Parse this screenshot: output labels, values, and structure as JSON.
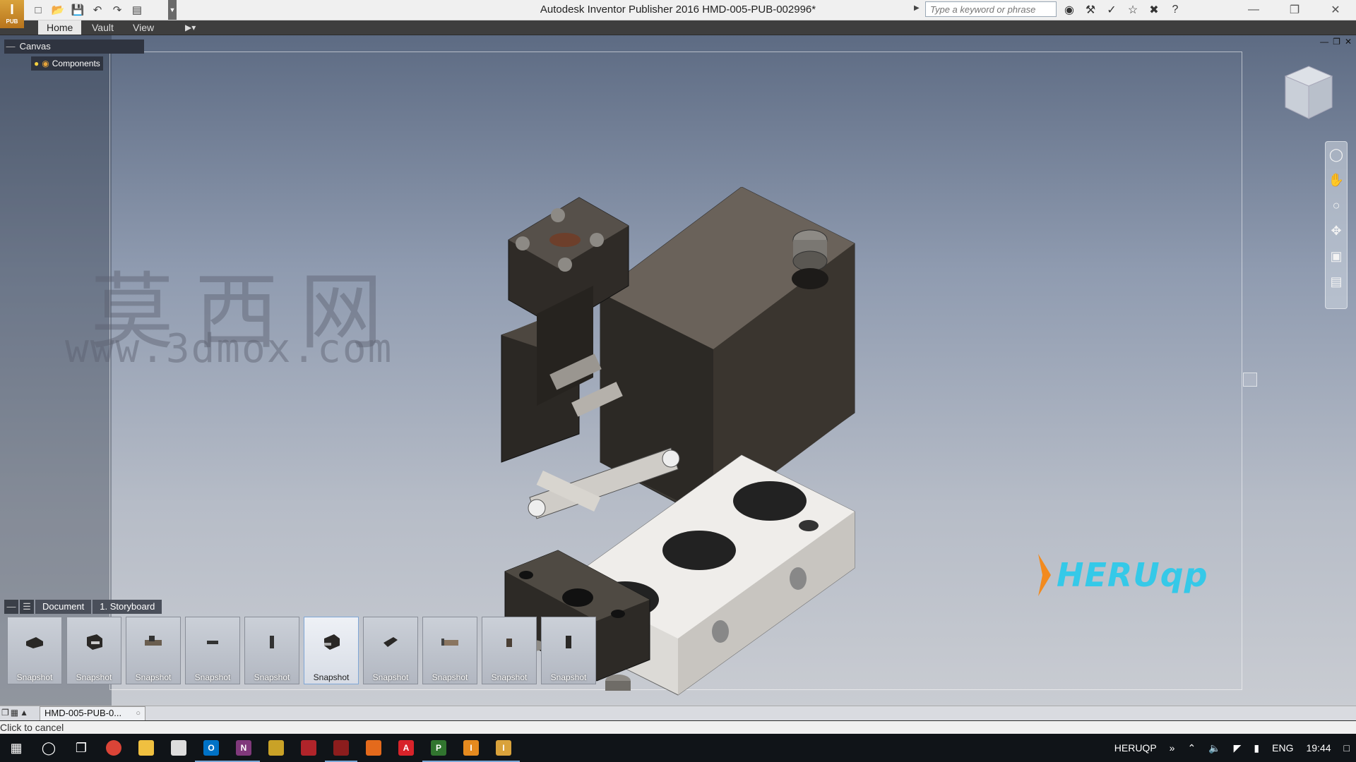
{
  "app": {
    "window_title": "Autodesk Inventor Publisher 2016    HMD-005-PUB-002996*",
    "logo_label": "PUB"
  },
  "search": {
    "placeholder": "Type a keyword or phrase"
  },
  "ribbon": {
    "tabs": [
      "Home",
      "Vault",
      "View"
    ],
    "active_tab": "Home"
  },
  "browser": {
    "header": "Canvas",
    "node": "Components"
  },
  "watermark": {
    "cn": "莫西网",
    "url": "www.3dmox.com"
  },
  "brand_logo": {
    "text": "HERUqp"
  },
  "storyboard": {
    "crumbs": [
      "Document",
      "1. Storyboard"
    ],
    "snapshots": [
      {
        "label": "Snapshot",
        "selected": false
      },
      {
        "label": "Snapshot",
        "selected": false
      },
      {
        "label": "Snapshot",
        "selected": false
      },
      {
        "label": "Snapshot",
        "selected": false
      },
      {
        "label": "Snapshot",
        "selected": false
      },
      {
        "label": "Snapshot",
        "selected": true
      },
      {
        "label": "Snapshot",
        "selected": false
      },
      {
        "label": "Snapshot",
        "selected": false
      },
      {
        "label": "Snapshot",
        "selected": false
      },
      {
        "label": "Snapshot",
        "selected": false
      }
    ]
  },
  "doc_tab": {
    "label": "HMD-005-PUB-0..."
  },
  "status": {
    "text": "Click to cancel"
  },
  "taskbar": {
    "apps": [
      "start-icon",
      "cortana-icon",
      "taskview-icon",
      "chrome-icon",
      "explorer-icon",
      "store-icon",
      "outlook-icon",
      "onenote-icon",
      "app-icon-1",
      "app-icon-2",
      "app-icon-3",
      "app-icon-4",
      "acrobat-icon",
      "project-icon",
      "inventor-icon",
      "inventor-publisher-icon"
    ],
    "user": "HERUQP",
    "lang": "ENG",
    "time": "19:44"
  },
  "colors": {
    "accent": "#35c9e8",
    "logo_orange": "#f28a1e"
  }
}
